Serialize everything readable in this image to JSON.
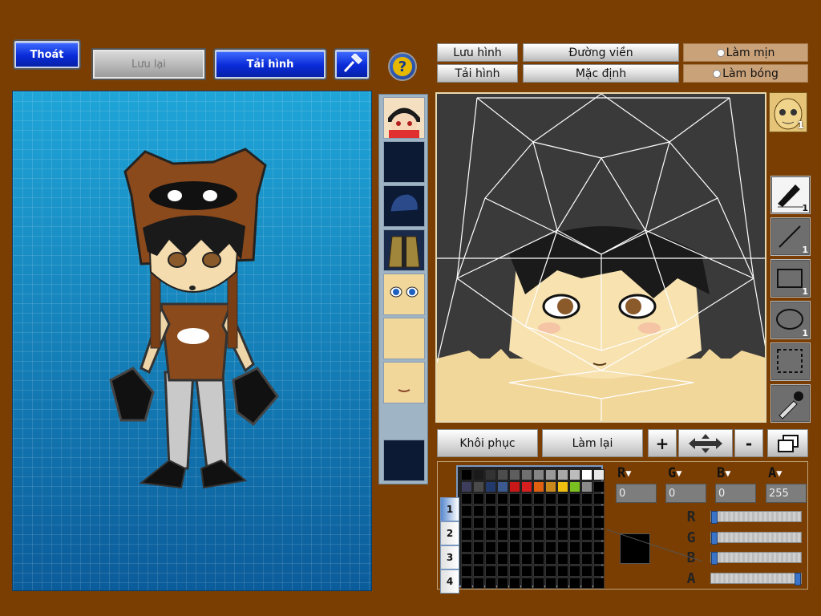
{
  "toolbar": {
    "exit_label": "Thoát",
    "save_label": "Lưu lại",
    "load_label": "Tải hình",
    "help_glyph": "?"
  },
  "editor_bar": {
    "save_image": "Lưu hình",
    "load_image": "Tải hình",
    "outline": "Đường viền",
    "default": "Mặc định",
    "smooth": "Làm mịn",
    "shade": "Làm bóng"
  },
  "editor_actions": {
    "restore": "Khôi phục",
    "redo": "Làm lại",
    "plus": "+",
    "minus": "-"
  },
  "layers": [
    "face-portrait",
    "empty",
    "helmet",
    "jacket",
    "eyes",
    "face-base",
    "mouth",
    "empty"
  ],
  "face_layer_badge": "1",
  "tools": [
    {
      "icon": "pen-icon",
      "count": "1"
    },
    {
      "icon": "line-icon",
      "count": "1"
    },
    {
      "icon": "rectangle-icon",
      "count": "1"
    },
    {
      "icon": "ellipse-icon",
      "count": "1"
    },
    {
      "icon": "selection-icon",
      "count": ""
    },
    {
      "icon": "eyedropper-icon",
      "count": ""
    }
  ],
  "palette": {
    "tabs": [
      "1",
      "2",
      "3",
      "4"
    ],
    "swatches": [
      "#000000",
      "#1a1a1a",
      "#333333",
      "#4d4d4d",
      "#5e5e5e",
      "#707070",
      "#858585",
      "#999999",
      "#a8a8a8",
      "#bcbcbc",
      "#ffffff",
      "#e8e8e8",
      "#3d3d5c",
      "#4a4a4a",
      "#223a6b",
      "#3c5a8f",
      "#c81818",
      "#d81f1f",
      "#e06010",
      "#c8881c",
      "#f0c010",
      "#7ac020",
      "#8a8a8a"
    ],
    "current_color": "#000000"
  },
  "channels": {
    "labels": [
      "R",
      "G",
      "B",
      "A"
    ],
    "values": [
      "0",
      "0",
      "0",
      "255"
    ],
    "slider_levels": [
      0,
      0,
      0,
      1
    ]
  },
  "colors": {
    "background": "#7a3e02",
    "accent_blue": "#0a2bd8"
  }
}
